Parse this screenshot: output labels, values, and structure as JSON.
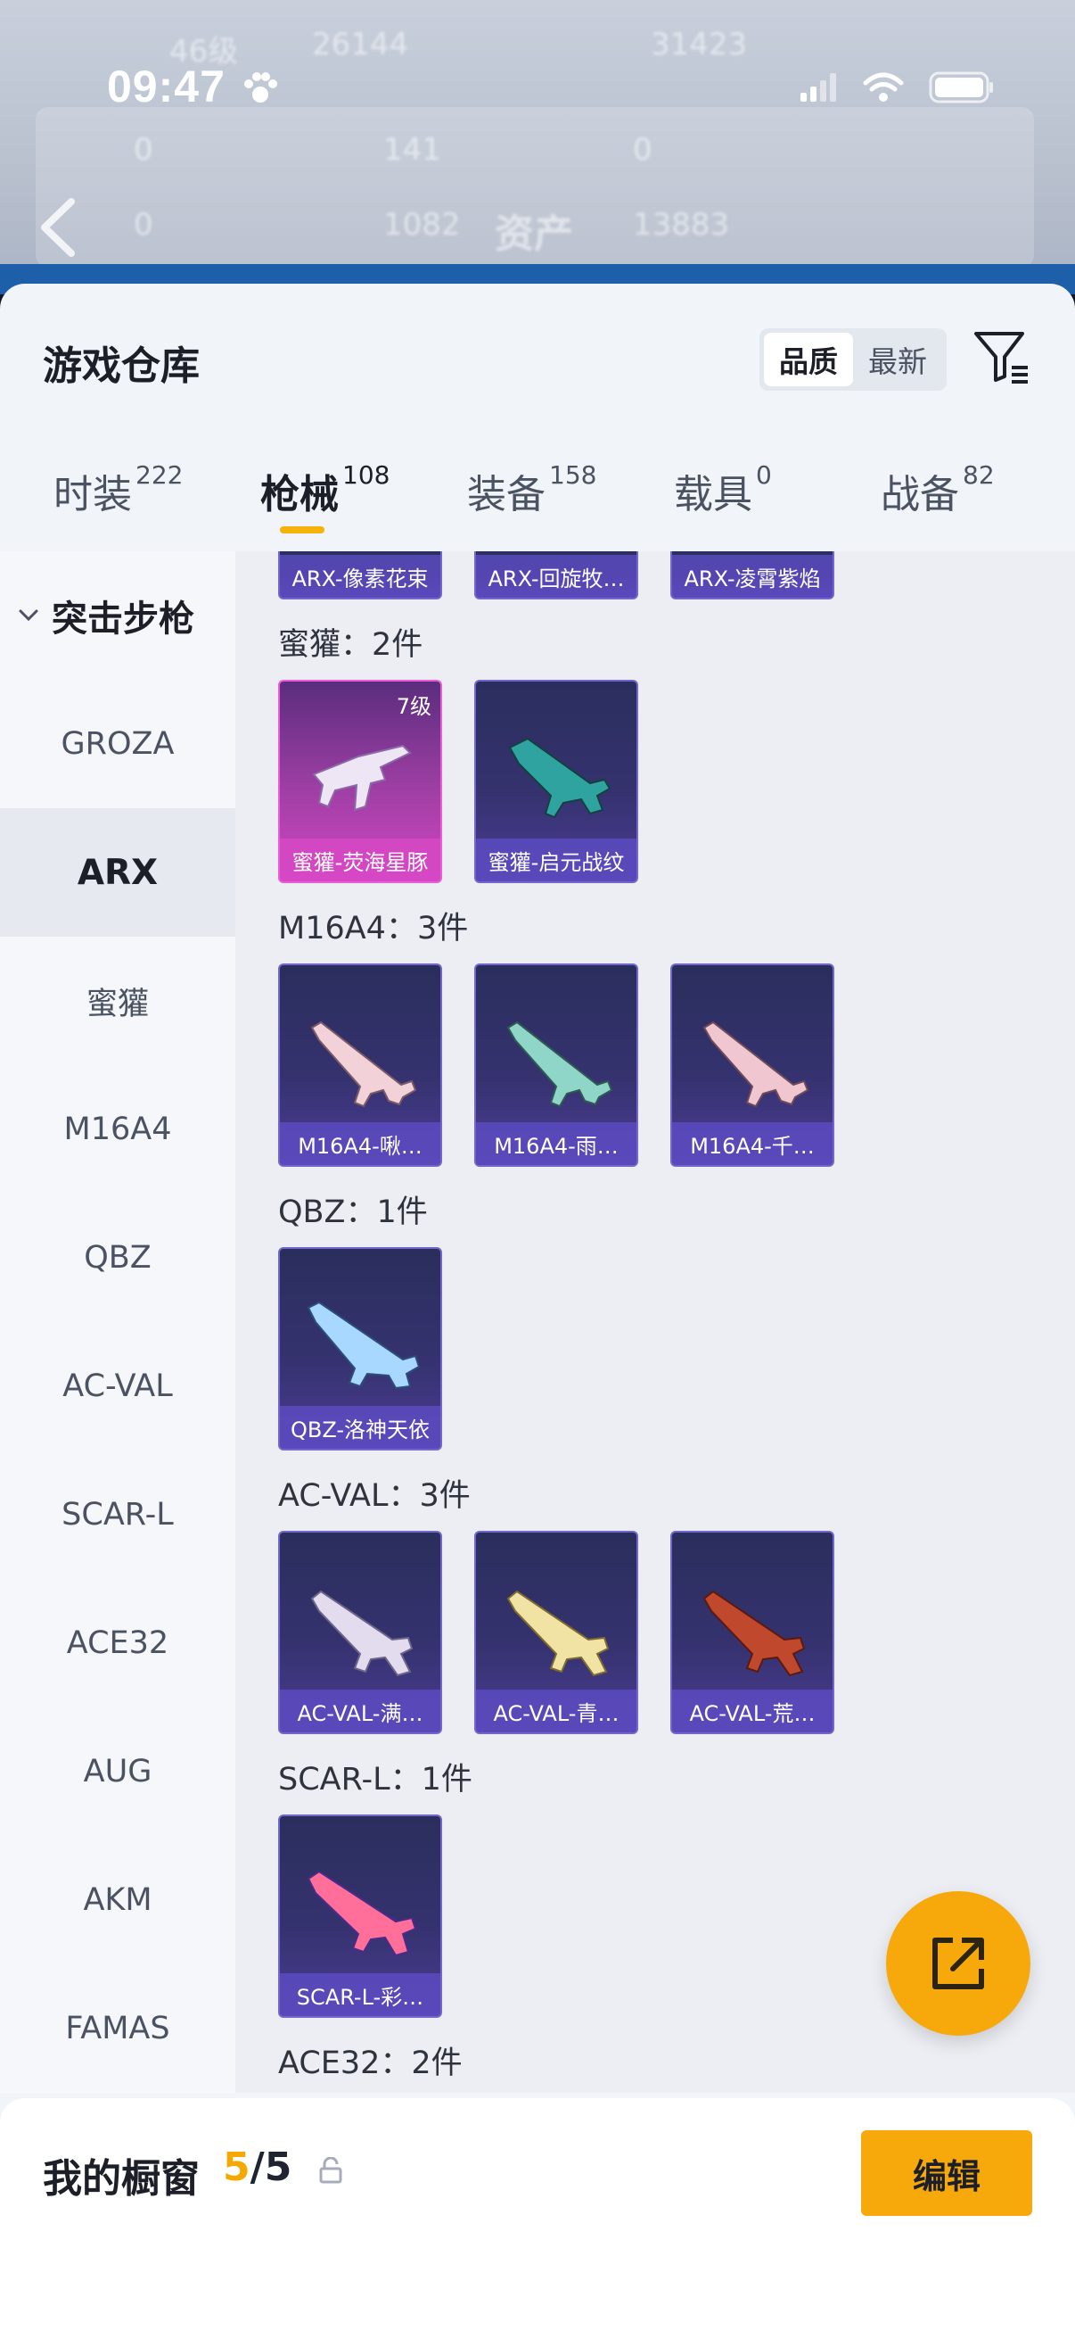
{
  "status": {
    "time": "09:47"
  },
  "background": {
    "row1": [
      "46级",
      "26144",
      "31423"
    ],
    "row2": [
      "0",
      "141",
      "0"
    ],
    "row3": [
      "0",
      "1082",
      "资产",
      "13883"
    ]
  },
  "sheet": {
    "title": "游戏仓库",
    "sort": {
      "quality": "品质",
      "latest": "最新"
    }
  },
  "tabs": [
    {
      "label": "时装",
      "count": "222"
    },
    {
      "label": "枪械",
      "count": "108"
    },
    {
      "label": "装备",
      "count": "158"
    },
    {
      "label": "载具",
      "count": "0"
    },
    {
      "label": "战备",
      "count": "82"
    }
  ],
  "sidebar": {
    "group": "突击步枪",
    "items": [
      "GROZA",
      "ARX",
      "蜜獾",
      "M16A4",
      "QBZ",
      "AC-VAL",
      "SCAR-L",
      "ACE32",
      "AUG",
      "AKM",
      "FAMAS"
    ]
  },
  "groups": {
    "arx_cards": [
      "ARX-像素花束",
      "ARX-回旋牧…",
      "ARX-凌霄紫焰"
    ],
    "mihuan": {
      "title": "蜜獾：2件",
      "cards": [
        "蜜獾-荧海星豚",
        "蜜獾-启元战纹"
      ],
      "level": "7级"
    },
    "m16": {
      "title": "M16A4：3件",
      "cards": [
        "M16A4-啾…",
        "M16A4-雨…",
        "M16A4-千…"
      ]
    },
    "qbz": {
      "title": "QBZ：1件",
      "cards": [
        "QBZ-洛神天依"
      ]
    },
    "acval": {
      "title": "AC-VAL：3件",
      "cards": [
        "AC-VAL-满…",
        "AC-VAL-青…",
        "AC-VAL-荒…"
      ]
    },
    "scar": {
      "title": "SCAR-L：1件",
      "cards": [
        "SCAR-L-彩…"
      ]
    },
    "ace32": {
      "title": "ACE32：2件"
    }
  },
  "showcase": {
    "title": "我的橱窗",
    "used": "5",
    "total": "/5",
    "edit_label": "编辑"
  },
  "colors": {
    "accent": "#f7a90b",
    "card_purple": "#35326f",
    "card_pink": "#d246c2"
  },
  "icons": [
    "signal-icon",
    "wifi-icon",
    "battery-icon",
    "paw-icon",
    "back-icon",
    "filter-icon",
    "chevron-down-icon",
    "share-icon",
    "lock-icon"
  ]
}
